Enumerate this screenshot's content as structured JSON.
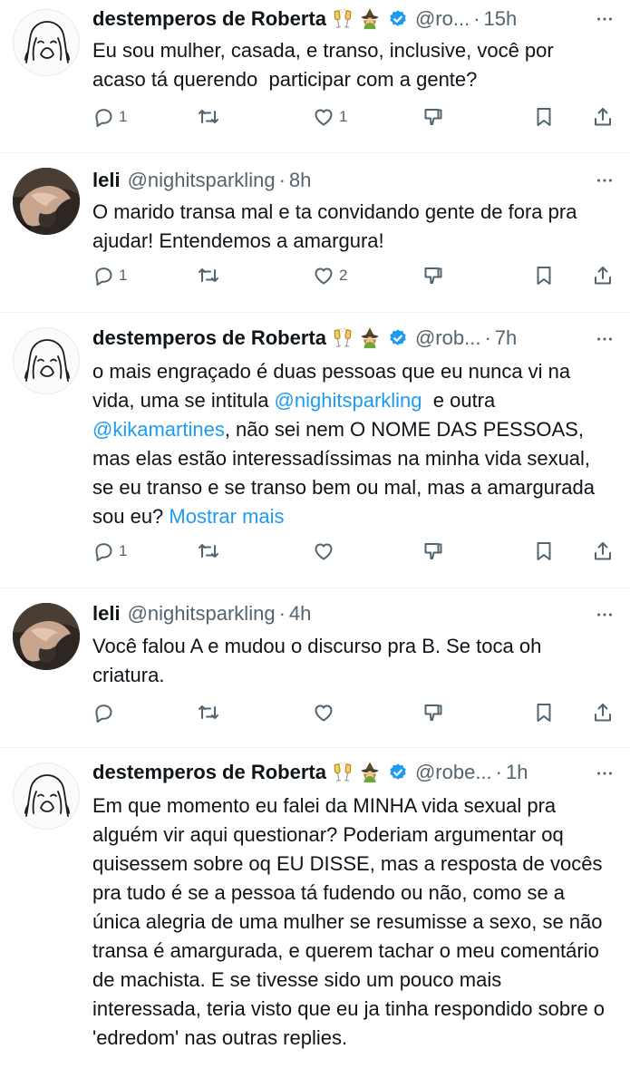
{
  "tweets": [
    {
      "name": "destemperos de Roberta",
      "handle": "@ro...",
      "time": "15h",
      "verified": true,
      "text": "Eu sou mulher, casada, e transo, inclusive, você por acaso tá querendo  participar com a gente?",
      "replies": "1",
      "retweets": "",
      "likes": "1"
    },
    {
      "name": "leli",
      "handle": "@nighitsparkling",
      "time": "8h",
      "verified": false,
      "text": "O marido transa mal e ta convidando gente de fora pra ajudar! Entendemos a amargura!",
      "replies": "1",
      "retweets": "",
      "likes": "2"
    },
    {
      "name": "destemperos de Roberta",
      "handle": "@rob...",
      "time": "7h",
      "verified": true,
      "text_parts": {
        "a": "o mais engraçado é duas pessoas que eu nunca vi na vida, uma se intitula ",
        "mention1": "@nighitsparkling",
        "b": "  e outra ",
        "mention2": "@kikamartines",
        "c": ", não sei nem O NOME DAS PESSOAS, mas elas estão interessadíssimas na minha vida sexual, se eu transo e se transo bem ou mal, mas a amargurada sou eu? ",
        "show_more": "Mostrar mais"
      },
      "replies": "1",
      "retweets": "",
      "likes": ""
    },
    {
      "name": "leli",
      "handle": "@nighitsparkling",
      "time": "4h",
      "verified": false,
      "text": "Você falou A e mudou o discurso pra B. Se toca oh criatura.",
      "replies": "",
      "retweets": "",
      "likes": ""
    },
    {
      "name": "destemperos de Roberta",
      "handle": "@robe...",
      "time": "1h",
      "verified": true,
      "text": "Em que momento eu falei da MINHA vida sexual pra alguém vir aqui questionar? Poderiam argumentar oq quisessem sobre oq EU DISSE, mas a resposta de vocês pra tudo é se a pessoa tá fudendo ou não, como se a única alegria de uma mulher se resumisse a sexo, se não transa é amargurada, e querem tachar o meu comentário de machista. E se tivesse sido um pouco mais interessada, teria visto que eu ja tinha respondido sobre o 'edredom' nas outras replies."
    }
  ],
  "separator": "·",
  "colors": {
    "text": "#0f1419",
    "secondary": "#536471",
    "link": "#1d9bf0",
    "verified": "#1d9bf0",
    "divider": "#eff3f4"
  },
  "icons": [
    "reply-icon",
    "retweet-icon",
    "like-icon",
    "dislike-icon",
    "bookmark-icon",
    "share-icon",
    "more-icon",
    "verified-icon",
    "champagne-emoji",
    "witch-emoji"
  ]
}
